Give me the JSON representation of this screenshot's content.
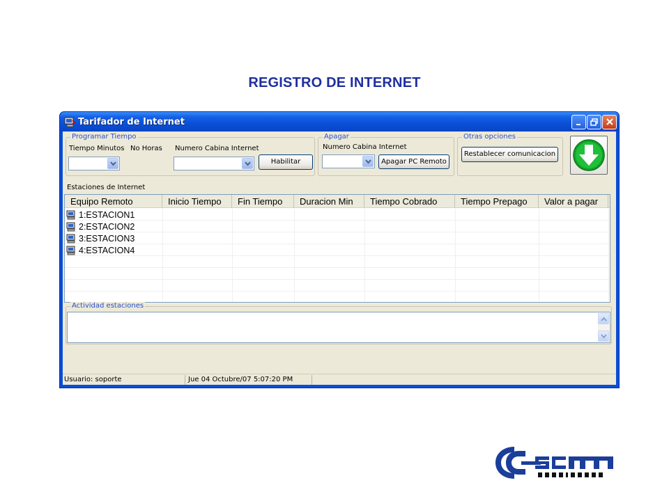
{
  "page": {
    "heading": "REGISTRO DE INTERNET"
  },
  "window": {
    "title": "Tarifador de Internet",
    "app_icon": "computer-icon",
    "controls": {
      "minimize": "minimize-icon",
      "restore": "restore-icon",
      "close": "close-icon"
    }
  },
  "programar": {
    "legend": "Programar Tiempo",
    "minutes_label": "Tiempo Minutos",
    "hours_label": "No Horas",
    "cabin_label": "Numero Cabina Internet",
    "habilitar_label": "Habilitar",
    "minutes_value": "",
    "cabin_value": ""
  },
  "apagar": {
    "legend": "Apagar",
    "cabin_label": "Numero Cabina Internet",
    "button_label": "Apagar PC Remoto",
    "cabin_value": ""
  },
  "otras": {
    "legend": "Otras opciones",
    "button_label": "Restablecer comunicacion"
  },
  "action_button": {
    "icon": "green-down-arrow-icon",
    "color": "#11a52a"
  },
  "stations": {
    "label": "Estaciones de Internet",
    "columns": [
      "Equipo Remoto",
      "Inicio Tiempo",
      "Fin Tiempo",
      "Duracion Min",
      "Tiempo Cobrado",
      "Tiempo Prepago",
      "Valor a pagar"
    ],
    "rows": [
      {
        "name": "1:ESTACION1",
        "icon": "computer-icon"
      },
      {
        "name": "2:ESTACION2",
        "icon": "computer-icon"
      },
      {
        "name": "3:ESTACION3",
        "icon": "computer-icon"
      },
      {
        "name": "4:ESTACION4",
        "icon": "computer-icon"
      }
    ]
  },
  "activity": {
    "legend": "Actividad estaciones",
    "text": ""
  },
  "statusbar": {
    "user": "Usuario: soporte",
    "datetime": "Jue 04 Octubre/07 5:07:20 PM"
  },
  "logo": {
    "text": "SCM",
    "subtext": "SOLUCIONES",
    "colors": {
      "primary": "#1a3e9a",
      "dark": "#111111"
    }
  },
  "colors": {
    "heading": "#1f2fa0",
    "titlebar": "#0a4ed6",
    "legend_text": "#2b50c8",
    "client_bg": "#ece9d8"
  }
}
